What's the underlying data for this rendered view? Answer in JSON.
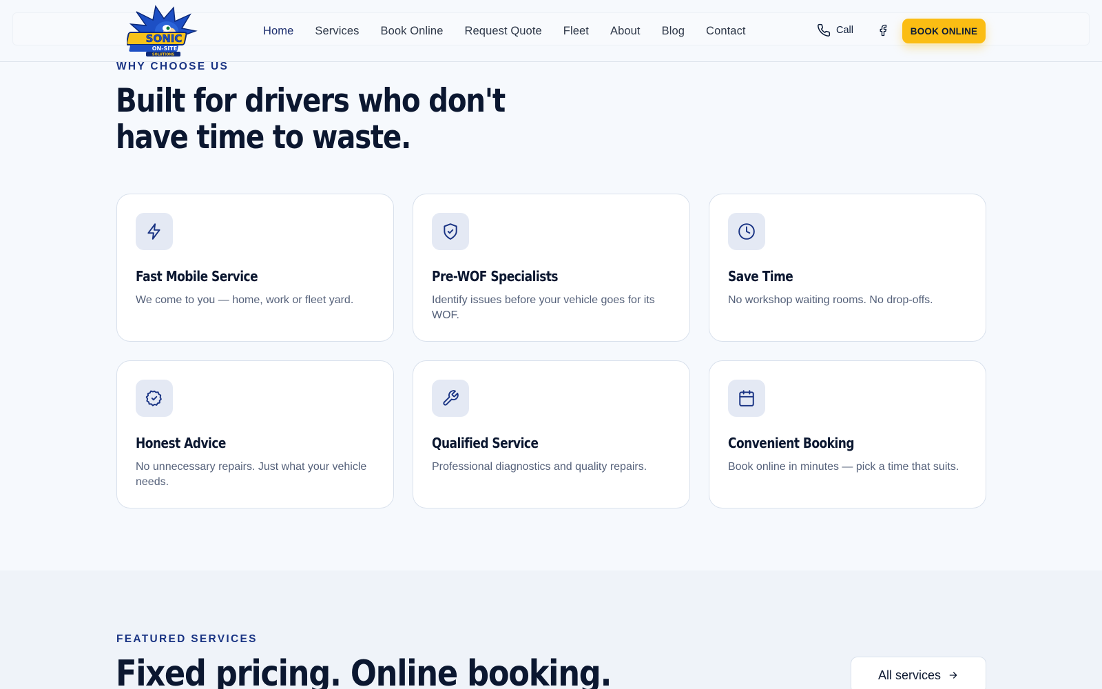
{
  "brand": {
    "logo_name": "Sonic On-Site Solutions",
    "logo_line1": "SONIC",
    "logo_line2": "ON-SITE",
    "logo_line3": "SOLUTIONS"
  },
  "nav": {
    "items": [
      {
        "label": "Home",
        "active": true
      },
      {
        "label": "Services"
      },
      {
        "label": "Book Online"
      },
      {
        "label": "Request Quote"
      },
      {
        "label": "Fleet"
      },
      {
        "label": "About"
      },
      {
        "label": "Blog"
      },
      {
        "label": "Contact"
      }
    ],
    "call_label": "Call",
    "call_icon": "phone-icon",
    "social_icon": "facebook-icon",
    "cta_label": "BOOK ONLINE"
  },
  "why": {
    "eyebrow": "WHY CHOOSE US",
    "headline": "Built for drivers who don't have time to waste.",
    "cards": [
      {
        "icon": "lightning-icon",
        "title": "Fast Mobile Service",
        "desc": "We come to you — home, work or fleet yard."
      },
      {
        "icon": "shield-check-icon",
        "title": "Pre-WOF Specialists",
        "desc": "Identify issues before your vehicle goes for its WOF."
      },
      {
        "icon": "clock-icon",
        "title": "Save Time",
        "desc": "No workshop waiting rooms. No drop-offs."
      },
      {
        "icon": "badge-check-icon",
        "title": "Honest Advice",
        "desc": "No unnecessary repairs. Just what your vehicle needs."
      },
      {
        "icon": "wrench-icon",
        "title": "Qualified Service",
        "desc": "Professional diagnostics and quality repairs."
      },
      {
        "icon": "calendar-icon",
        "title": "Convenient Booking",
        "desc": "Book online in minutes — pick a time that suits."
      }
    ]
  },
  "featured": {
    "eyebrow": "FEATURED SERVICES",
    "headline": "Fixed pricing. Online booking.",
    "all_label": "All services",
    "all_icon": "arrow-right-icon"
  },
  "colors": {
    "accent_blue": "#1a3484",
    "cta_yellow": "#fbbd13",
    "ink": "#0b1730",
    "icon_tile": "#e4e9f4"
  }
}
